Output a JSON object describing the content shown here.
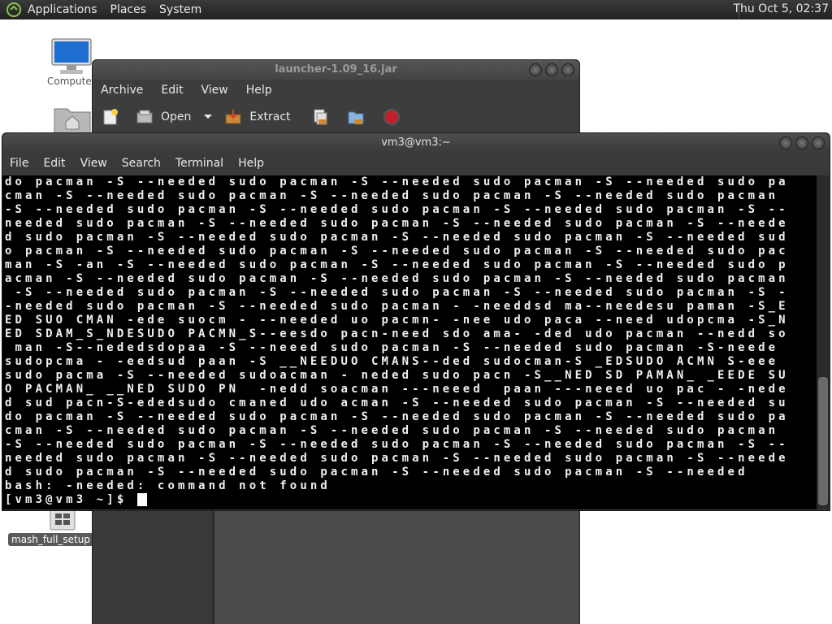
{
  "top_panel": {
    "menus": [
      "Applications",
      "Places",
      "System"
    ],
    "clock": "Thu Oct  5, 02:37"
  },
  "desktop": {
    "computer_label": "Computer",
    "setup_label": "mash_full_setup"
  },
  "archive_window": {
    "title": "launcher-1.09_16.jar",
    "menus": [
      "Archive",
      "Edit",
      "View",
      "Help"
    ],
    "toolbar": {
      "open_label": "Open",
      "extract_label": "Extract"
    }
  },
  "terminal_window": {
    "title": "vm3@vm3:~",
    "menus": [
      "File",
      "Edit",
      "View",
      "Search",
      "Terminal",
      "Help"
    ],
    "lines": [
      "do pacman -S --needed sudo pacman -S --needed sudo pacman -S --needed sudo pa",
      "cman -S --needed sudo pacman -S --needed sudo pacman -S --needed sudo pacman ",
      "-S --needed sudo pacman -S --needed sudo pacman -S --needed sudo pacman -S --",
      "needed sudo pacman -S --needed sudo pacman -S --needed sudo pacman -S --neede",
      "d sudo pacman -S --needed sudo pacman -S --needed sudo pacman -S --needed sud",
      "o pacman -S --needed sudo pacman -S --needed sudo pacman -S --needed sudo pac",
      "man -S -an -S --needed sudo pacman -S --needed sudo pacman -S --needed sudo p",
      "acman -S --needed sudo pacman -S --needed sudo pacman -S --needed sudo pacman",
      " -S --needed sudo pacman -S --needed sudo pacman -S --needed sudo pacman -S -",
      "-needed sudo pacman -S --needed sudo pacman - -needdsd ma--needesu paman -S_E",
      "ED SUO CMAN -ede suocm - --needed uo pacmn- -nee udo paca --need udopcma -S_N",
      "ED SDAM_S_NDESUDO PACMN_S--eesdo pacn-need sdo ama- -ded udo pacman --nedd so",
      " man -S--nededsdopaa -S --neeed sudo pacman -S --needed sudo pacman -S-neede",
      "sudopcma - -eedsud paan -S __NEEDUO CMANS--ded sudocman-S _EDSUDO ACMN S-eee",
      "sudo pacma -S --needed sudoacman - neded sudo pacn -S__NED SD PAMAN_ _EEDE SU",
      "O PACMAN_ __NED SUDO PN  -nedd soacman ---neeed  paan ---neeed uo pac - -nede",
      "d sud pacn-S-ededsudo cmaned udo acman -S --needed sudo pacman -S --needed su",
      "do pacman -S --needed sudo pacman -S --needed sudo pacman -S --needed sudo pa",
      "cman -S --needed sudo pacman -S --needed sudo pacman -S --needed sudo pacman ",
      "-S --needed sudo pacman -S --needed sudo pacman -S --needed sudo pacman -S --",
      "needed sudo pacman -S --needed sudo pacman -S --needed sudo pacman -S --neede",
      "d sudo pacman -S --needed sudo pacman -S --needed sudo pacman -S --needed",
      "bash: -needed: command not found"
    ],
    "prompt": "[vm3@vm3 ~]$ "
  }
}
